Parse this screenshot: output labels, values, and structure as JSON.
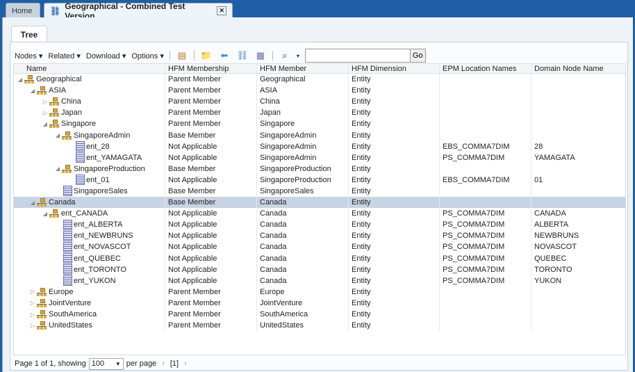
{
  "tabs": {
    "home": "Home",
    "active": "Geographical - Combined Test Version"
  },
  "subtab": "Tree",
  "toolbar": {
    "nodes": "Nodes",
    "related": "Related",
    "download": "Download",
    "options": "Options",
    "go": "Go",
    "search_value": ""
  },
  "columns": [
    "Name",
    "HFM Membership",
    "HFM Member",
    "HFM Dimension",
    "EPM Location Names",
    "Domain Node Name"
  ],
  "rows": [
    {
      "level": 0,
      "exp": "open",
      "icon": "hier",
      "name": "Geographical",
      "membership": "Parent Member",
      "member": "Geographical",
      "dim": "Entity",
      "epm": "",
      "domain": ""
    },
    {
      "level": 1,
      "exp": "open",
      "icon": "hier",
      "name": "ASIA",
      "membership": "Parent Member",
      "member": "ASIA",
      "dim": "Entity",
      "epm": "",
      "domain": ""
    },
    {
      "level": 2,
      "exp": "closed",
      "icon": "hier",
      "name": "China",
      "membership": "Parent Member",
      "member": "China",
      "dim": "Entity",
      "epm": "",
      "domain": ""
    },
    {
      "level": 2,
      "exp": "closed",
      "icon": "hier",
      "name": "Japan",
      "membership": "Parent Member",
      "member": "Japan",
      "dim": "Entity",
      "epm": "",
      "domain": ""
    },
    {
      "level": 2,
      "exp": "open",
      "icon": "hier",
      "name": "Singapore",
      "membership": "Parent Member",
      "member": "Singapore",
      "dim": "Entity",
      "epm": "",
      "domain": ""
    },
    {
      "level": 3,
      "exp": "open",
      "icon": "hier",
      "name": "SingaporeAdmin",
      "membership": "Base Member",
      "member": "SingaporeAdmin",
      "dim": "Entity",
      "epm": "",
      "domain": ""
    },
    {
      "level": 4,
      "exp": "none",
      "icon": "leaf",
      "name": "ent_28",
      "membership": "Not Applicable",
      "member": "SingaporeAdmin",
      "dim": "Entity",
      "epm": "EBS_COMMA7DIM",
      "domain": "28"
    },
    {
      "level": 4,
      "exp": "none",
      "icon": "leaf",
      "name": "ent_YAMAGATA",
      "membership": "Not Applicable",
      "member": "SingaporeAdmin",
      "dim": "Entity",
      "epm": "PS_COMMA7DIM",
      "domain": "YAMAGATA"
    },
    {
      "level": 3,
      "exp": "open",
      "icon": "hier",
      "name": "SingaporeProduction",
      "membership": "Base Member",
      "member": "SingaporeProduction",
      "dim": "Entity",
      "epm": "",
      "domain": ""
    },
    {
      "level": 4,
      "exp": "none",
      "icon": "leaf",
      "name": "ent_01",
      "membership": "Not Applicable",
      "member": "SingaporeProduction",
      "dim": "Entity",
      "epm": "EBS_COMMA7DIM",
      "domain": "01"
    },
    {
      "level": 3,
      "exp": "none",
      "icon": "leaf",
      "name": "SingaporeSales",
      "membership": "Base Member",
      "member": "SingaporeSales",
      "dim": "Entity",
      "epm": "",
      "domain": ""
    },
    {
      "level": 1,
      "exp": "open",
      "icon": "hier",
      "name": "Canada",
      "membership": "Base Member",
      "member": "Canada",
      "dim": "Entity",
      "epm": "",
      "domain": "",
      "selected": true
    },
    {
      "level": 2,
      "exp": "open",
      "icon": "hier",
      "name": "ent_CANADA",
      "membership": "Not Applicable",
      "member": "Canada",
      "dim": "Entity",
      "epm": "PS_COMMA7DIM",
      "domain": "CANADA"
    },
    {
      "level": 3,
      "exp": "none",
      "icon": "leaf",
      "name": "ent_ALBERTA",
      "membership": "Not Applicable",
      "member": "Canada",
      "dim": "Entity",
      "epm": "PS_COMMA7DIM",
      "domain": "ALBERTA"
    },
    {
      "level": 3,
      "exp": "none",
      "icon": "leaf",
      "name": "ent_NEWBRUNS",
      "membership": "Not Applicable",
      "member": "Canada",
      "dim": "Entity",
      "epm": "PS_COMMA7DIM",
      "domain": "NEWBRUNS"
    },
    {
      "level": 3,
      "exp": "none",
      "icon": "leaf",
      "name": "ent_NOVASCOT",
      "membership": "Not Applicable",
      "member": "Canada",
      "dim": "Entity",
      "epm": "PS_COMMA7DIM",
      "domain": "NOVASCOT"
    },
    {
      "level": 3,
      "exp": "none",
      "icon": "leaf",
      "name": "ent_QUEBEC",
      "membership": "Not Applicable",
      "member": "Canada",
      "dim": "Entity",
      "epm": "PS_COMMA7DIM",
      "domain": "QUEBEC"
    },
    {
      "level": 3,
      "exp": "none",
      "icon": "leaf",
      "name": "ent_TORONTO",
      "membership": "Not Applicable",
      "member": "Canada",
      "dim": "Entity",
      "epm": "PS_COMMA7DIM",
      "domain": "TORONTO"
    },
    {
      "level": 3,
      "exp": "none",
      "icon": "leaf",
      "name": "ent_YUKON",
      "membership": "Not Applicable",
      "member": "Canada",
      "dim": "Entity",
      "epm": "PS_COMMA7DIM",
      "domain": "YUKON"
    },
    {
      "level": 1,
      "exp": "closed",
      "icon": "hier",
      "name": "Europe",
      "membership": "Parent Member",
      "member": "Europe",
      "dim": "Entity",
      "epm": "",
      "domain": ""
    },
    {
      "level": 1,
      "exp": "closed",
      "icon": "hier",
      "name": "JointVenture",
      "membership": "Parent Member",
      "member": "JointVenture",
      "dim": "Entity",
      "epm": "",
      "domain": ""
    },
    {
      "level": 1,
      "exp": "closed",
      "icon": "hier",
      "name": "SouthAmerica",
      "membership": "Parent Member",
      "member": "SouthAmerica",
      "dim": "Entity",
      "epm": "",
      "domain": ""
    },
    {
      "level": 1,
      "exp": "closed",
      "icon": "hier",
      "name": "UnitedStates",
      "membership": "Parent Member",
      "member": "UnitedStates",
      "dim": "Entity",
      "epm": "",
      "domain": ""
    }
  ],
  "footer": {
    "page_text": "Page 1 of 1, showing",
    "per_page_value": "100",
    "per_page_label": "per page",
    "prev": "‹",
    "page": "[1]",
    "next": "›"
  }
}
